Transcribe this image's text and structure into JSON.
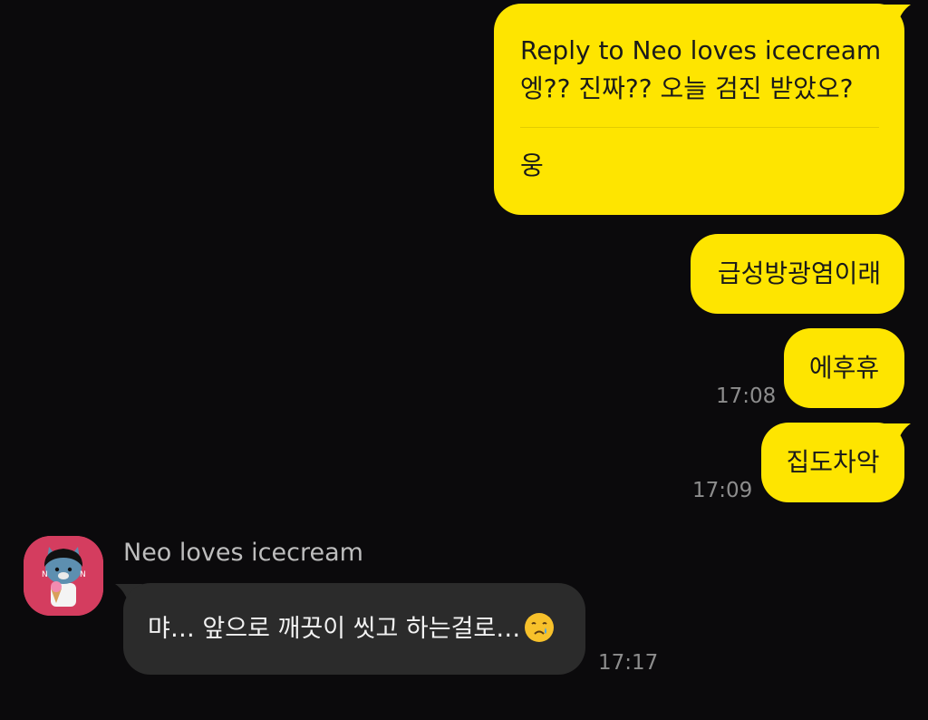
{
  "messages_out": [
    {
      "reply_header": "Reply to Neo loves icecream",
      "quoted_text": "엥?? 진짜?? 오늘 검진 받았오?",
      "text": "웅"
    },
    {
      "text": "급성방광염이래"
    },
    {
      "text": "에후휴",
      "time": "17:08"
    },
    {
      "text": "집도차악",
      "time": "17:09"
    }
  ],
  "message_in": {
    "sender": "Neo loves icecream",
    "avatar_icon": "neo-character-icon",
    "text": "먀… 앞으로 깨끗이 씻고 하는걸로…",
    "emoji_icon": "teary-face-emoji-icon",
    "time": "17:17"
  },
  "colors": {
    "background": "#0b0a0c",
    "outgoing_bubble": "#fee500",
    "incoming_bubble": "#2b2b2b",
    "avatar_bg": "#d43d5f",
    "timestamp": "#8d8d8d"
  }
}
